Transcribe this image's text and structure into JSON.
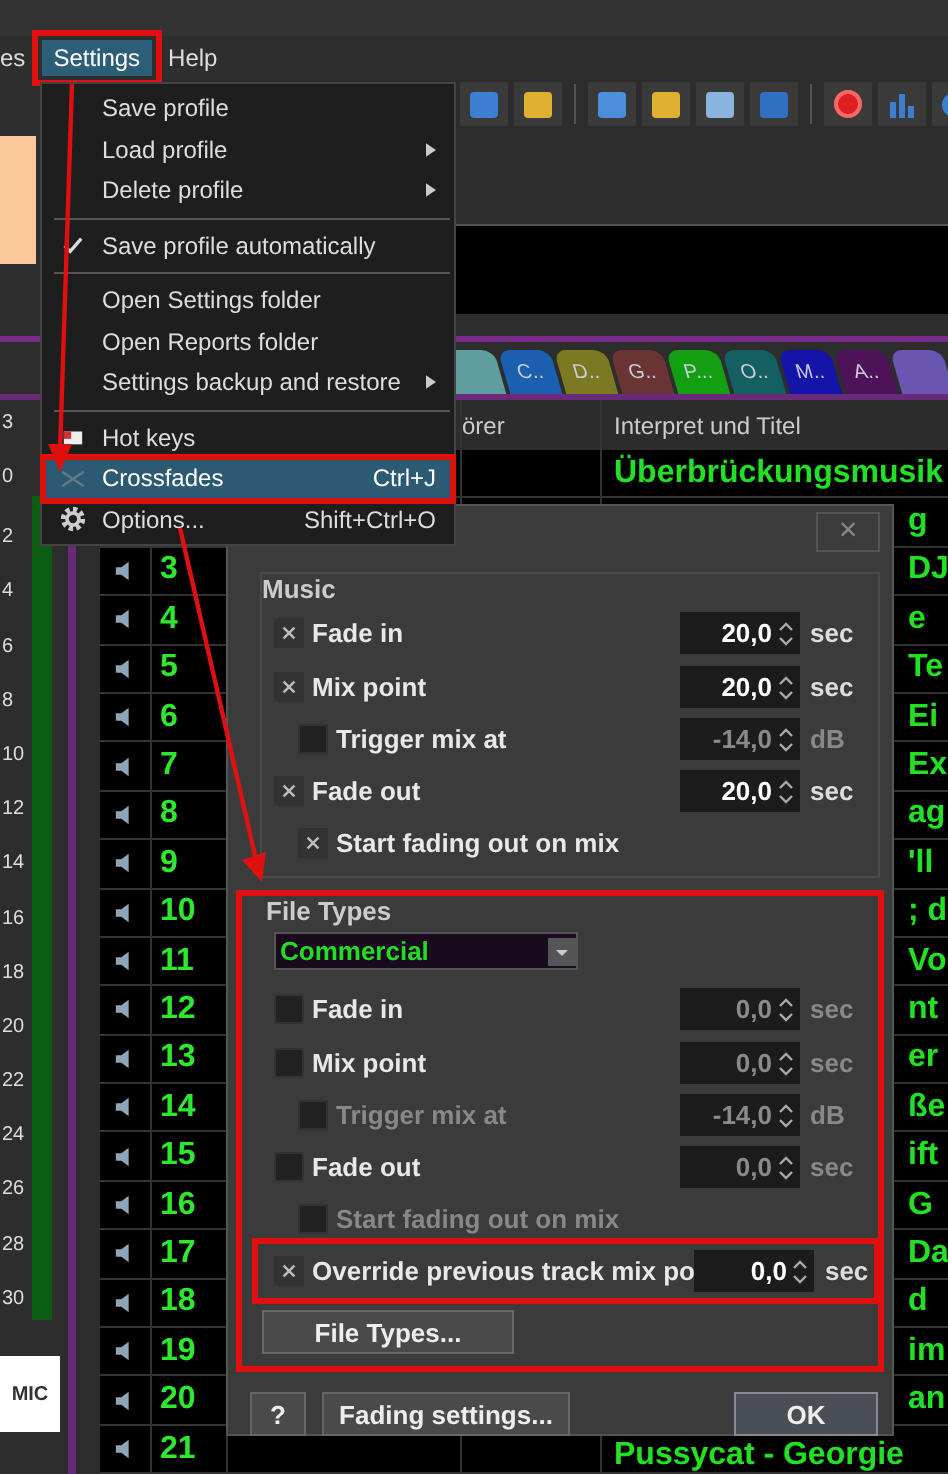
{
  "menubar": [
    {
      "label": "es",
      "selected": false,
      "annotated": false
    },
    {
      "label": "Settings",
      "selected": true,
      "annotated": true
    },
    {
      "label": "Help",
      "selected": false,
      "annotated": false
    }
  ],
  "settings_menu": [
    {
      "kind": "item",
      "label": "Save profile",
      "submenu": false,
      "checked": false,
      "selected": false,
      "annotated": false
    },
    {
      "kind": "item",
      "label": "Load profile",
      "submenu": true,
      "checked": false,
      "selected": false,
      "annotated": false
    },
    {
      "kind": "item",
      "label": "Delete profile",
      "submenu": true,
      "checked": false,
      "selected": false,
      "annotated": false
    },
    {
      "kind": "separator"
    },
    {
      "kind": "item",
      "label": "Save profile automatically",
      "submenu": false,
      "checked": true,
      "selected": false,
      "annotated": false
    },
    {
      "kind": "separator"
    },
    {
      "kind": "item",
      "label": "Open Settings folder",
      "submenu": false,
      "checked": false,
      "selected": false,
      "annotated": false
    },
    {
      "kind": "item",
      "label": "Open Reports folder",
      "submenu": false,
      "checked": false,
      "selected": false,
      "annotated": false
    },
    {
      "kind": "item",
      "label": "Settings backup and restore",
      "submenu": true,
      "checked": false,
      "selected": false,
      "annotated": false
    },
    {
      "kind": "separator"
    },
    {
      "kind": "item",
      "label": "Hot keys",
      "submenu": false,
      "checked": false,
      "selected": false,
      "annotated": false
    },
    {
      "kind": "item",
      "label": "Crossfades",
      "shortcut": "Ctrl+J",
      "submenu": false,
      "checked": false,
      "selected": true,
      "annotated": true
    },
    {
      "kind": "item",
      "label": "Options...",
      "shortcut": "Shift+Ctrl+O",
      "submenu": false,
      "checked": false,
      "selected": false,
      "annotated": false
    }
  ],
  "tabs": [
    {
      "color": "#5f9e9e"
    },
    {
      "label": "C..",
      "color": "#1a5fb0"
    },
    {
      "label": "D..",
      "color": "#7b7a22"
    },
    {
      "label": "G..",
      "color": "#6a3434"
    },
    {
      "label": "P...",
      "color": "#12a012"
    },
    {
      "label": "O..",
      "color": "#135f62"
    },
    {
      "label": "M..",
      "color": "#1414a8"
    },
    {
      "label": "A..",
      "color": "#4e1258"
    },
    {
      "color": "#6a55b0"
    }
  ],
  "meter": {
    "scale": [
      "3",
      "0",
      "2",
      "4",
      "6",
      "8",
      "10",
      "12",
      "14",
      "16",
      "18",
      "20",
      "22",
      "24",
      "26",
      "28",
      "30"
    ],
    "level": 1,
    "mic_button": "MIC"
  },
  "table": {
    "columns": [
      "örer",
      "Interpret und Titel"
    ],
    "rows": [
      {
        "kind": "full",
        "title": "Überbrückungsmusik"
      },
      {
        "kind": "partial",
        "title": "g"
      },
      {
        "kind": "partial",
        "number": "3",
        "title": "DJ"
      },
      {
        "kind": "partial",
        "number": "4",
        "title": "e"
      },
      {
        "kind": "partial",
        "number": "5",
        "title": "Te"
      },
      {
        "kind": "partial",
        "number": "6",
        "title": "Ei"
      },
      {
        "kind": "partial",
        "number": "7",
        "title": "Ex"
      },
      {
        "kind": "partial",
        "number": "8",
        "title": "ag"
      },
      {
        "kind": "partial",
        "number": "9",
        "title": "'ll"
      },
      {
        "kind": "partial",
        "number": "10",
        "title": "; d"
      },
      {
        "kind": "partial",
        "number": "11",
        "title": "Vo"
      },
      {
        "kind": "partial",
        "number": "12",
        "title": "nt"
      },
      {
        "kind": "partial",
        "number": "13",
        "title": "er"
      },
      {
        "kind": "partial",
        "number": "14",
        "title": "ße"
      },
      {
        "kind": "partial",
        "number": "15",
        "title": "ift"
      },
      {
        "kind": "partial",
        "number": "16",
        "title": "G"
      },
      {
        "kind": "partial",
        "number": "17",
        "title": "Da"
      },
      {
        "kind": "partial",
        "number": "18",
        "title": "d"
      },
      {
        "kind": "partial",
        "number": "19",
        "title": "im"
      },
      {
        "kind": "partial",
        "number": "20",
        "title": "an"
      },
      {
        "kind": "full",
        "number": "21",
        "title": "Pussycat - Georgie"
      }
    ]
  },
  "dialog": {
    "close": "×",
    "music": {
      "title": "Music",
      "options": [
        {
          "label": "Fade in",
          "checked": true,
          "disabled": false,
          "input": {
            "value": "20,0",
            "unit": "sec",
            "disabled": false
          }
        },
        {
          "label": "Mix point",
          "checked": true,
          "disabled": false,
          "input": {
            "value": "20,0",
            "unit": "sec",
            "disabled": false
          },
          "children": [
            {
              "label": "Trigger mix at",
              "checked": false,
              "disabled": false,
              "input": {
                "value": "-14,0",
                "unit": "dB",
                "disabled": true
              }
            }
          ]
        },
        {
          "label": "Fade out",
          "checked": true,
          "disabled": false,
          "input": {
            "value": "20,0",
            "unit": "sec",
            "disabled": false
          },
          "children": [
            {
              "label": "Start fading out on mix",
              "checked": true,
              "disabled": false
            }
          ]
        }
      ]
    },
    "file_types": {
      "title": "File Types",
      "annotated": true,
      "type_select": "Commercial",
      "options": [
        {
          "label": "Fade in",
          "checked": false,
          "disabled": false,
          "input": {
            "value": "0,0",
            "unit": "sec",
            "disabled": true
          }
        },
        {
          "label": "Mix point",
          "checked": false,
          "disabled": false,
          "input": {
            "value": "0,0",
            "unit": "sec",
            "disabled": true
          },
          "children": [
            {
              "label": "Trigger mix at",
              "checked": false,
              "disabled": true,
              "input": {
                "value": "-14,0",
                "unit": "dB",
                "disabled": true
              }
            }
          ]
        },
        {
          "label": "Fade out",
          "checked": false,
          "disabled": false,
          "input": {
            "value": "0,0",
            "unit": "sec",
            "disabled": true
          },
          "children": [
            {
              "label": "Start fading out on mix",
              "checked": false,
              "disabled": true
            }
          ]
        },
        {
          "label": "Override previous track mix po",
          "checked": true,
          "disabled": false,
          "annotated": true,
          "input": {
            "value": "0,0",
            "unit": "sec",
            "disabled": false
          }
        }
      ],
      "button": "File Types..."
    },
    "buttons": [
      {
        "label": "?",
        "kind": "help"
      },
      {
        "label": "Fading settings...",
        "kind": "normal"
      },
      {
        "label": "OK",
        "kind": "default"
      }
    ]
  }
}
